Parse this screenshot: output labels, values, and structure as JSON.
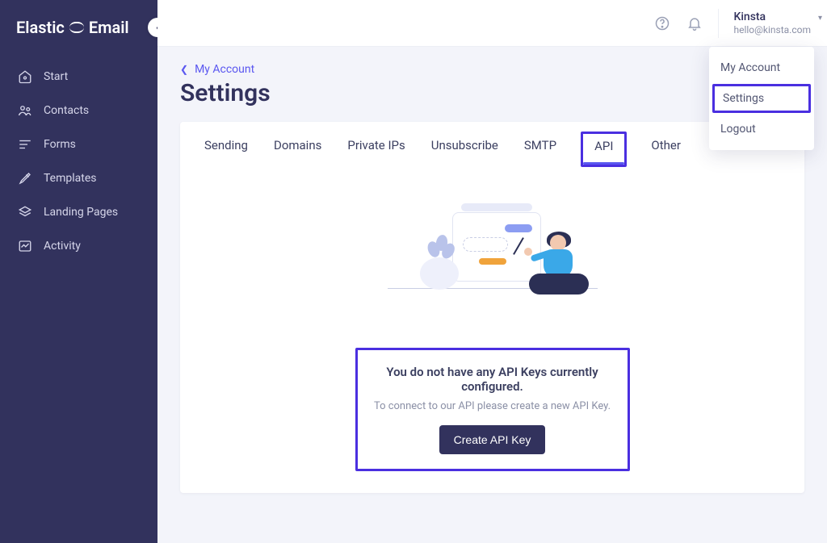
{
  "brand": {
    "word1": "Elastic",
    "word2": "Email"
  },
  "sidebar": {
    "items": [
      {
        "label": "Start"
      },
      {
        "label": "Contacts"
      },
      {
        "label": "Forms"
      },
      {
        "label": "Templates"
      },
      {
        "label": "Landing Pages"
      },
      {
        "label": "Activity"
      }
    ]
  },
  "user": {
    "name": "Kinsta",
    "email": "hello@kinsta.com"
  },
  "dropdown": {
    "items": [
      {
        "label": "My Account"
      },
      {
        "label": "Settings"
      },
      {
        "label": "Logout"
      }
    ]
  },
  "breadcrumb": {
    "label": "My Account"
  },
  "page": {
    "title": "Settings"
  },
  "tabs": [
    {
      "label": "Sending"
    },
    {
      "label": "Domains"
    },
    {
      "label": "Private IPs"
    },
    {
      "label": "Unsubscribe"
    },
    {
      "label": "SMTP"
    },
    {
      "label": "API"
    },
    {
      "label": "Other"
    }
  ],
  "empty": {
    "title": "You do not have any API Keys currently configured.",
    "subtitle": "To connect to our API please create a new API Key.",
    "button": "Create API Key"
  }
}
